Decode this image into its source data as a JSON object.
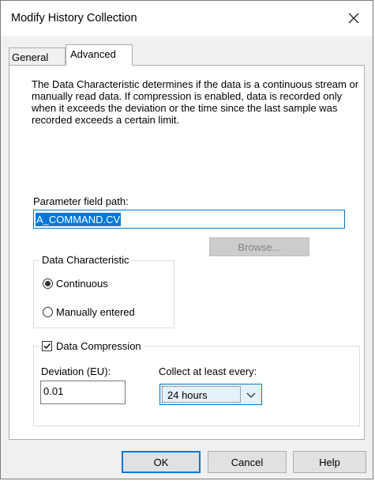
{
  "window": {
    "title": "Modify History Collection",
    "close_label": "Close"
  },
  "tabs": [
    {
      "label": "General",
      "active": false
    },
    {
      "label": "Advanced",
      "active": true
    }
  ],
  "advanced": {
    "description": "The Data Characteristic determines if the data is a continuous stream or manually read data. If compression is enabled, data is recorded only when it exceeds the deviation or the time since the last sample was recorded exceeds a certain limit.",
    "parameter_label": "Parameter field path:",
    "parameter_value": "A_COMMAND.CV",
    "browse_label": "Browse...",
    "data_characteristic": {
      "legend": "Data Characteristic",
      "options": [
        "Continuous",
        "Manually entered"
      ],
      "selected": "Continuous"
    },
    "compression": {
      "legend": "Data Compression",
      "checked": true,
      "deviation_label": "Deviation (EU):",
      "deviation_value": "0.01",
      "collect_label": "Collect at least every:",
      "collect_value": "24 hours"
    }
  },
  "buttons": {
    "ok": "OK",
    "cancel": "Cancel",
    "help": "Help"
  },
  "colors": {
    "accent": "#0078d7",
    "dialog_bg": "#f0f0f0",
    "panel_bg": "#ffffff"
  }
}
